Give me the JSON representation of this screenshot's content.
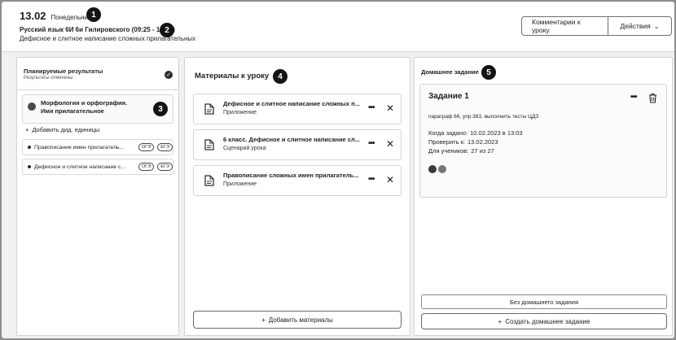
{
  "header": {
    "date": "13.02",
    "weekday": "Понедельник",
    "lesson": "Русский язык 6И 6и Гилировского (09:25 - 10:10)",
    "topic": "Дефисное и слитное написание сложных прилагательных",
    "comment_button": "Комментарии к уроку",
    "actions_button": "Действия",
    "callout_1": "1",
    "callout_2": "2"
  },
  "left": {
    "planned_title": "Планируемые результаты",
    "planned_subtitle": "Результаты отмечены",
    "topic_marker": "",
    "topic_text": "Морфология и орфография. Имя прилагательное",
    "callout_3": "3",
    "add_units": "Добавить дид. единицы",
    "skills": [
      {
        "text": "Правописание имен прилагатель...",
        "badges": [
          "ОГЭ",
          "ЕГЭ"
        ]
      },
      {
        "text": "Дефисное и слитное написание с...",
        "badges": [
          "ОГЭ",
          "ЕГЭ"
        ]
      }
    ]
  },
  "middle": {
    "title": "Материалы к уроку",
    "callout_4": "4",
    "materials": [
      {
        "title": "Дефисное и слитное написание сложных п...",
        "type": "Приложение"
      },
      {
        "title": "6 класс. Дефисное и слитное написание сл...",
        "type": "Сценарий урока"
      },
      {
        "title": "Правописание сложных имен прилагатель...",
        "type": "Приложение"
      }
    ],
    "add_materials": "Добавить материалы"
  },
  "right": {
    "title": "Домашнее задание",
    "callout_5": "5",
    "task": {
      "title": "Задание 1",
      "description": "параграф 66, упр.383, выполнить тесты ЦДЗ",
      "assigned_label": "Когда задано:",
      "assigned_value": "10.02.2023 в 13:03",
      "check_label": "Проверить к:",
      "check_value": "13.02.2023",
      "students_label": "Для учеников:",
      "students_value": "27 из 27"
    },
    "no_homework": "Без домашнего задания",
    "create_homework": "Создать домашнее задание"
  },
  "icons": {
    "chevron": "chevron-down-icon",
    "plus": "plus-icon",
    "close": "close-icon",
    "more": "more-icon",
    "trash": "trash-icon",
    "document": "document-icon",
    "check": "check-circle-icon"
  }
}
